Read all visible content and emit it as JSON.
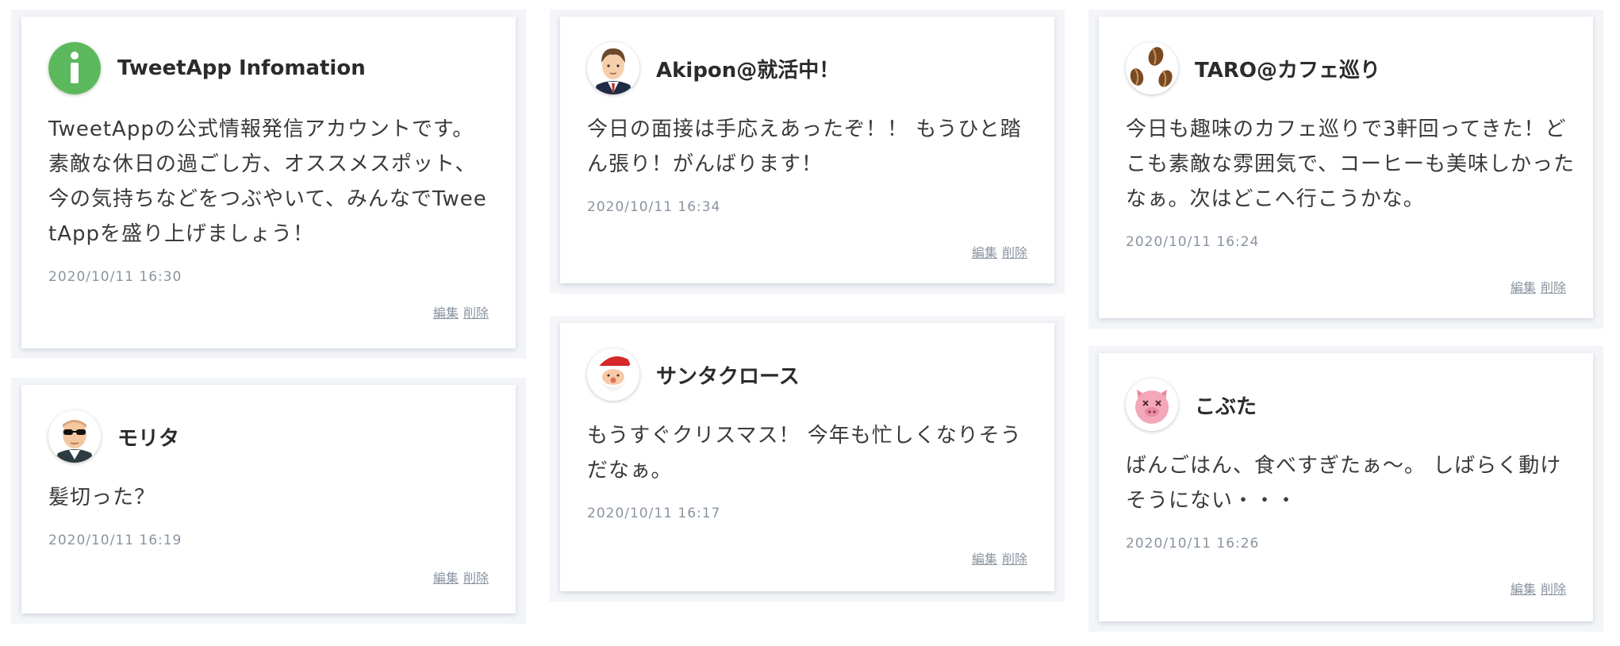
{
  "actions": {
    "edit_label": "編集",
    "delete_label": "削除"
  },
  "posts": [
    {
      "user_name": "TweetApp Infomation",
      "avatar_icon": "info-icon",
      "content": "TweetAppの公式情報発信アカウントです。素敵な休日の過ごし方、オススメスポット、今の気持ちなどをつぶやいて、みんなでTweetAppを盛り上げましょう！",
      "created_at": "2020/10/11 16:30"
    },
    {
      "user_name": "モリタ",
      "avatar_icon": "man-sunglasses-icon",
      "content": "髪切った？",
      "created_at": "2020/10/11 16:19"
    },
    {
      "user_name": "Akipon@就活中！",
      "avatar_icon": "businessman-icon",
      "content": "今日の面接は手応えあったぞ！！ もうひと踏ん張り！がんばります！",
      "created_at": "2020/10/11 16:34"
    },
    {
      "user_name": "サンタクロース",
      "avatar_icon": "santa-icon",
      "content": "もうすぐクリスマス！ 今年も忙しくなりそうだなぁ。",
      "created_at": "2020/10/11 16:17"
    },
    {
      "user_name": "TARO@カフェ巡り",
      "avatar_icon": "coffee-beans-icon",
      "content": "今日も趣味のカフェ巡りで3軒回ってきた！どこも素敵な雰囲気で、コーヒーも美味しかったなぁ。次はどこへ行こうかな。",
      "created_at": "2020/10/11 16:24"
    },
    {
      "user_name": "こぶた",
      "avatar_icon": "pig-icon",
      "content": "ばんごはん、食べすぎたぁ〜。 しばらく動けそうにない・・・",
      "created_at": "2020/10/11 16:26"
    }
  ]
}
